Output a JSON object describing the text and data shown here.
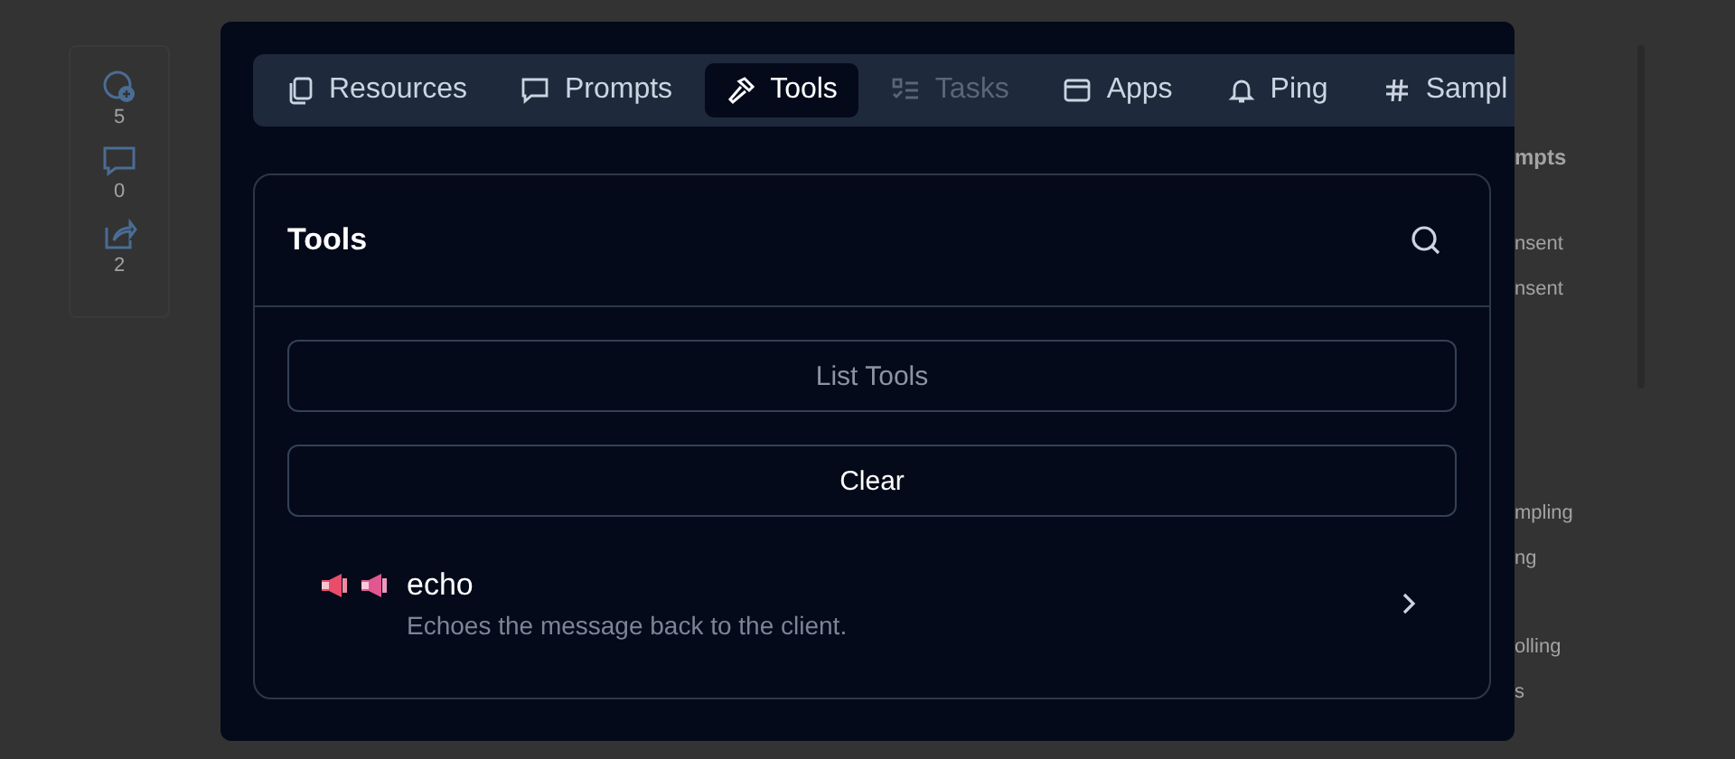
{
  "reactions": [
    {
      "kind": "emoji",
      "count": "5"
    },
    {
      "kind": "comment",
      "count": "0"
    },
    {
      "kind": "share",
      "count": "2"
    }
  ],
  "background_texts": [
    {
      "text": "mpts",
      "bold": true
    },
    {
      "text": "nsent",
      "bold": false
    },
    {
      "text": "nsent",
      "bold": false
    },
    {
      "text": "mpling",
      "bold": false
    },
    {
      "text": "ng",
      "bold": false
    },
    {
      "text": "olling",
      "bold": false
    },
    {
      "text": "s",
      "bold": false
    }
  ],
  "tabs": [
    {
      "kind": "resources",
      "label": "Resources",
      "selected": false,
      "disabled": false
    },
    {
      "kind": "prompts",
      "label": "Prompts",
      "selected": false,
      "disabled": false
    },
    {
      "kind": "tools",
      "label": "Tools",
      "selected": true,
      "disabled": false
    },
    {
      "kind": "tasks",
      "label": "Tasks",
      "selected": false,
      "disabled": true
    },
    {
      "kind": "apps",
      "label": "Apps",
      "selected": false,
      "disabled": false
    },
    {
      "kind": "ping",
      "label": "Ping",
      "selected": false,
      "disabled": false
    },
    {
      "kind": "sampling",
      "label": "Sampl",
      "selected": false,
      "disabled": false
    }
  ],
  "panel": {
    "title": "Tools",
    "buttons": [
      {
        "label": "List Tools",
        "disabled": true
      },
      {
        "label": "Clear",
        "disabled": false
      }
    ],
    "tools": [
      {
        "name": "echo",
        "description": "Echoes the message back to the client."
      }
    ]
  }
}
